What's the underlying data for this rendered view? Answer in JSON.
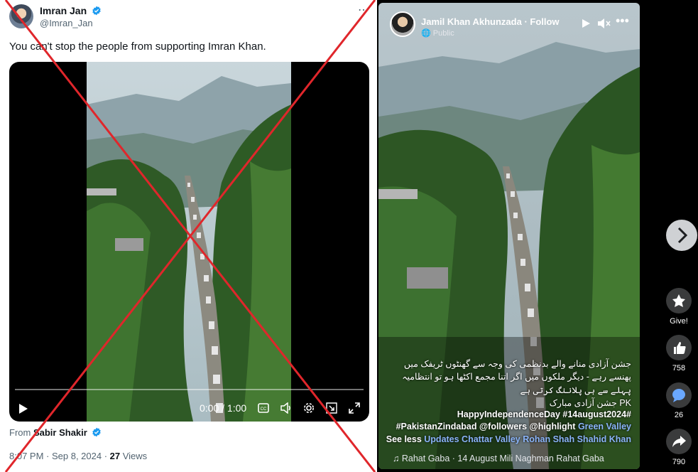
{
  "left_post": {
    "author_name": "Imran Jan",
    "author_handle": "@Imran_Jan",
    "text": "You can't stop the people from supporting Imran Khan.",
    "video": {
      "time": "0:00 / 1:00",
      "progress": 0
    },
    "from_prefix": "From ",
    "from_name": "Sabir Shakir",
    "timestamp": "8:07 PM · Sep 8, 2024 · ",
    "views_count": "27",
    "views_label": " Views"
  },
  "right_post": {
    "author_name": "Jamil Khan Akhunzada · Follow",
    "audience": "Public",
    "caption_urdu_1": "جشن آزادی منانے والے بدنظمی کی وجہ سے گھنٹوں ٹریفک میں",
    "caption_urdu_2": "پھنسے رہے - دیگر ملکوں میں اگر اتنا مجمع اکٹھا ہو تو انتظامیہ",
    "caption_urdu_3": "پہلے سے ہی پلاننگ کرتی ہے",
    "caption_urdu_4": "جشن آزادی مبارک PK",
    "hashtags_1": "HappyIndependenceDay #14august2024#",
    "hashtags_2_a": "#PakistanZindabad @followers @highlight ",
    "hashtags_2_b": "Green Valley",
    "see_less": "See less ",
    "links": "Updates Chattar Valley Rohan Shah Shahid Khan",
    "audio": "Rahat Gaba · 14 August Mili Naghman      Rahat Gaba",
    "actions": {
      "give_label": "Give!",
      "likes": "758",
      "comments": "26",
      "shares": "790"
    }
  },
  "colors": {
    "x_blue": "#1d9bf0",
    "overlay_red": "#e0262b",
    "fb_link": "#8ab4f8"
  }
}
